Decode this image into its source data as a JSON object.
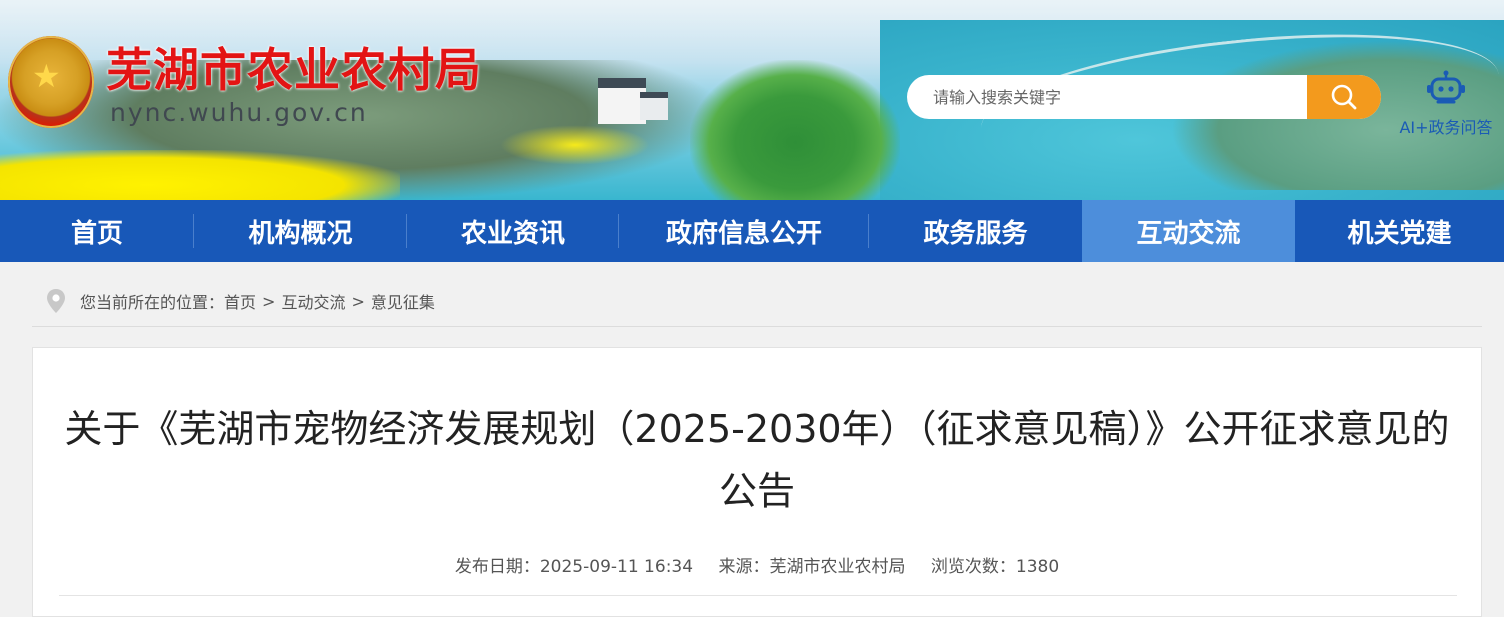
{
  "header": {
    "site_title": "芜湖市农业农村局",
    "site_domain": "nync.wuhu.gov.cn",
    "search": {
      "placeholder": "请输入搜索关键字"
    },
    "ai_assistant_label": "AI+政务问答"
  },
  "nav": {
    "items": [
      {
        "label": "首页"
      },
      {
        "label": "机构概况"
      },
      {
        "label": "农业资讯"
      },
      {
        "label": "政府信息公开"
      },
      {
        "label": "政务服务"
      },
      {
        "label": "互动交流",
        "active": true
      },
      {
        "label": "机关党建"
      }
    ]
  },
  "breadcrumb": {
    "prefix": "您当前所在的位置：",
    "items": [
      "首页",
      "互动交流",
      "意见征集"
    ],
    "separator": ">"
  },
  "article": {
    "title": "关于《芜湖市宠物经济发展规划（2025-2030年）（征求意见稿）》公开征求意见的公告",
    "publish_date_label": "发布日期：",
    "publish_date": "2025-09-11 16:34",
    "source_label": "来源：",
    "source": "芜湖市农业农村局",
    "views_label": "浏览次数：",
    "views": "1380"
  },
  "colors": {
    "nav_bg": "#1858b8",
    "nav_active_bg": "#4d8edb",
    "title_red": "#e31414",
    "search_button": "#f39a1d",
    "ai_blue": "#1a5bb5"
  },
  "icons": [
    "national-emblem-icon",
    "search-icon",
    "robot-icon",
    "location-pin-icon"
  ]
}
